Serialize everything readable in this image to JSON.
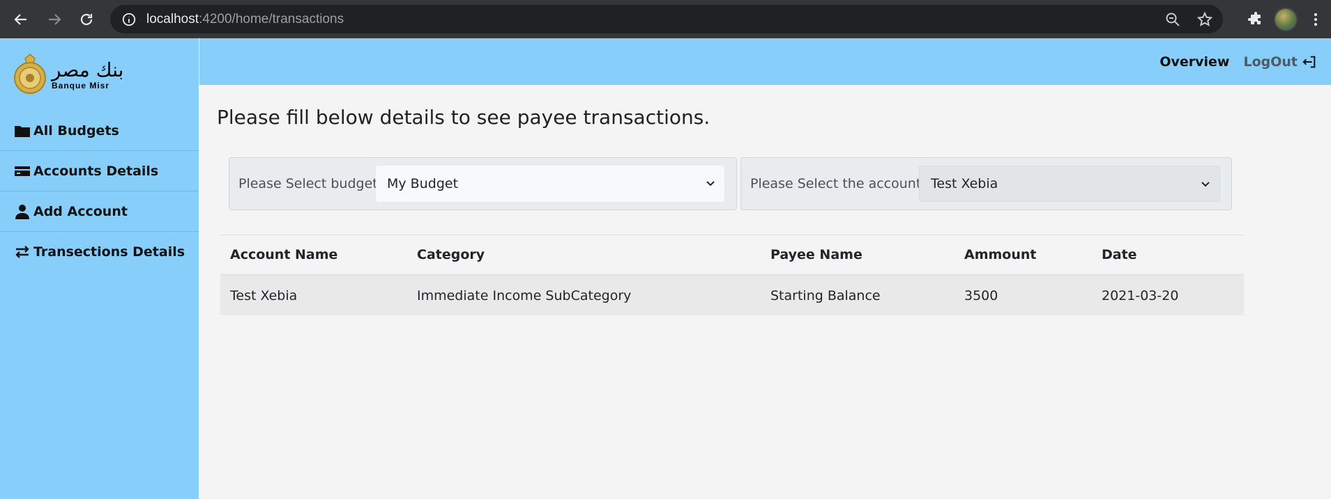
{
  "browser": {
    "url_host": "localhost",
    "url_path": ":4200/home/transactions"
  },
  "brand": {
    "arabic": "بنك مصر",
    "latin": "Banque Misr"
  },
  "sidebar": {
    "items": [
      {
        "label": "All Budgets",
        "icon": "folder-icon"
      },
      {
        "label": "Accounts Details",
        "icon": "credit-card-icon"
      },
      {
        "label": "Add Account",
        "icon": "user-icon"
      },
      {
        "label": "Transections Details",
        "icon": "exchange-arrows-icon"
      }
    ]
  },
  "header": {
    "overview": "Overview",
    "logout": "LogOut"
  },
  "main": {
    "heading": "Please fill below details to see payee transactions.",
    "budget_label": "Please Select budget:",
    "budget_value": "My Budget",
    "account_label": "Please Select the account :",
    "account_value": "Test Xebia"
  },
  "table": {
    "columns": [
      "Account Name",
      "Category",
      "Payee Name",
      "Ammount",
      "Date"
    ],
    "rows": [
      [
        "Test Xebia",
        "Immediate Income SubCategory",
        "Starting Balance",
        "3500",
        "2021-03-20"
      ]
    ]
  }
}
